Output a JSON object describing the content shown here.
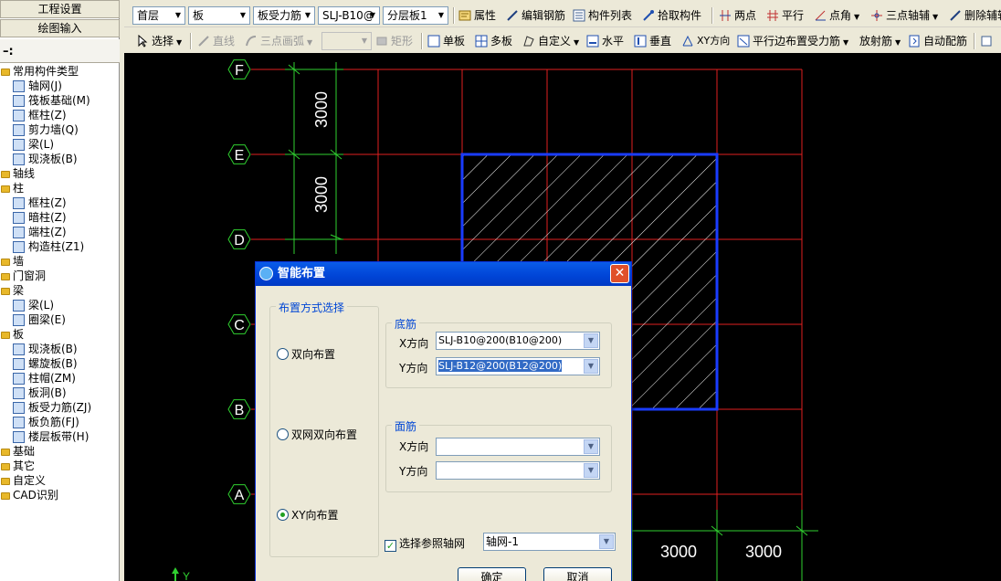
{
  "left_panel": {
    "btn_project_settings": "工程设置",
    "btn_drawing_input": "绘图输入",
    "tree": [
      {
        "label": "常用构件类型",
        "level": 0,
        "folder": true
      },
      {
        "label": "轴网(J)",
        "level": 1
      },
      {
        "label": "筏板基础(M)",
        "level": 1
      },
      {
        "label": "框柱(Z)",
        "level": 1
      },
      {
        "label": "剪力墙(Q)",
        "level": 1
      },
      {
        "label": "梁(L)",
        "level": 1
      },
      {
        "label": "现浇板(B)",
        "level": 1
      },
      {
        "label": "轴线",
        "level": 0,
        "folder": true
      },
      {
        "label": "柱",
        "level": 0,
        "folder": true
      },
      {
        "label": "框柱(Z)",
        "level": 1
      },
      {
        "label": "暗柱(Z)",
        "level": 1
      },
      {
        "label": "端柱(Z)",
        "level": 1
      },
      {
        "label": "构造柱(Z1)",
        "level": 1
      },
      {
        "label": "墙",
        "level": 0,
        "folder": true
      },
      {
        "label": "门窗洞",
        "level": 0,
        "folder": true
      },
      {
        "label": "梁",
        "level": 0,
        "folder": true
      },
      {
        "label": "梁(L)",
        "level": 1
      },
      {
        "label": "圈梁(E)",
        "level": 1
      },
      {
        "label": "板",
        "level": 0,
        "folder": true
      },
      {
        "label": "现浇板(B)",
        "level": 1
      },
      {
        "label": "螺旋板(B)",
        "level": 1
      },
      {
        "label": "柱帽(ZM)",
        "level": 1
      },
      {
        "label": "板洞(B)",
        "level": 1
      },
      {
        "label": "板受力筋(ZJ)",
        "level": 1
      },
      {
        "label": "板负筋(FJ)",
        "level": 1
      },
      {
        "label": "楼层板带(H)",
        "level": 1
      },
      {
        "label": "基础",
        "level": 0,
        "folder": true
      },
      {
        "label": "其它",
        "level": 0,
        "folder": true
      },
      {
        "label": "自定义",
        "level": 0,
        "folder": true
      },
      {
        "label": "CAD识别",
        "level": 0,
        "folder": true
      }
    ]
  },
  "toolbar1": {
    "floor": "首层",
    "component_type": "板",
    "rebar_type": "板受力筋",
    "component_name": "SLJ-B10@",
    "layer": "分层板1",
    "attributes": "属性",
    "edit_rebar": "编辑钢筋",
    "component_list": "构件列表",
    "pick_component": "拾取构件",
    "two_points": "两点",
    "parallel": "平行",
    "point_angle": "点角",
    "three_point_axis": "三点轴辅",
    "delete_aux": "删除辅轴"
  },
  "toolbar2": {
    "select": "选择",
    "line": "直线",
    "three_point_arc": "三点画弧",
    "rect": "矩形",
    "single_slab": "单板",
    "multi_slab": "多板",
    "custom": "自定义",
    "horizontal": "水平",
    "vertical": "垂直",
    "xy_direction": "XY方向",
    "parallel_edge": "平行边布置受力筋",
    "radial": "放射筋",
    "auto_rebar": "自动配筋"
  },
  "canvas": {
    "axis_labels": [
      "F",
      "E",
      "D",
      "C",
      "B",
      "A"
    ],
    "dim_vertical": [
      "3000",
      "3000"
    ],
    "dim_horizontal": [
      "3000",
      "3000"
    ]
  },
  "dialog": {
    "title": "智能布置",
    "layout_group": "布置方式选择",
    "radio_two_way": "双向布置",
    "radio_double_two_way": "双网双向布置",
    "radio_xy": "XY向布置",
    "bottom_group": "底筋",
    "top_group": "面筋",
    "x_dir": "X方向",
    "y_dir": "Y方向",
    "bottom_x_value": "SLJ-B10@200(B10@200)",
    "bottom_y_value": "SLJ-B12@200(B12@200)",
    "top_x_value": "",
    "top_y_value": "",
    "ref_axis_label": "选择参照轴网",
    "ref_axis_value": "轴网-1",
    "ok": "确定",
    "cancel": "取消"
  }
}
